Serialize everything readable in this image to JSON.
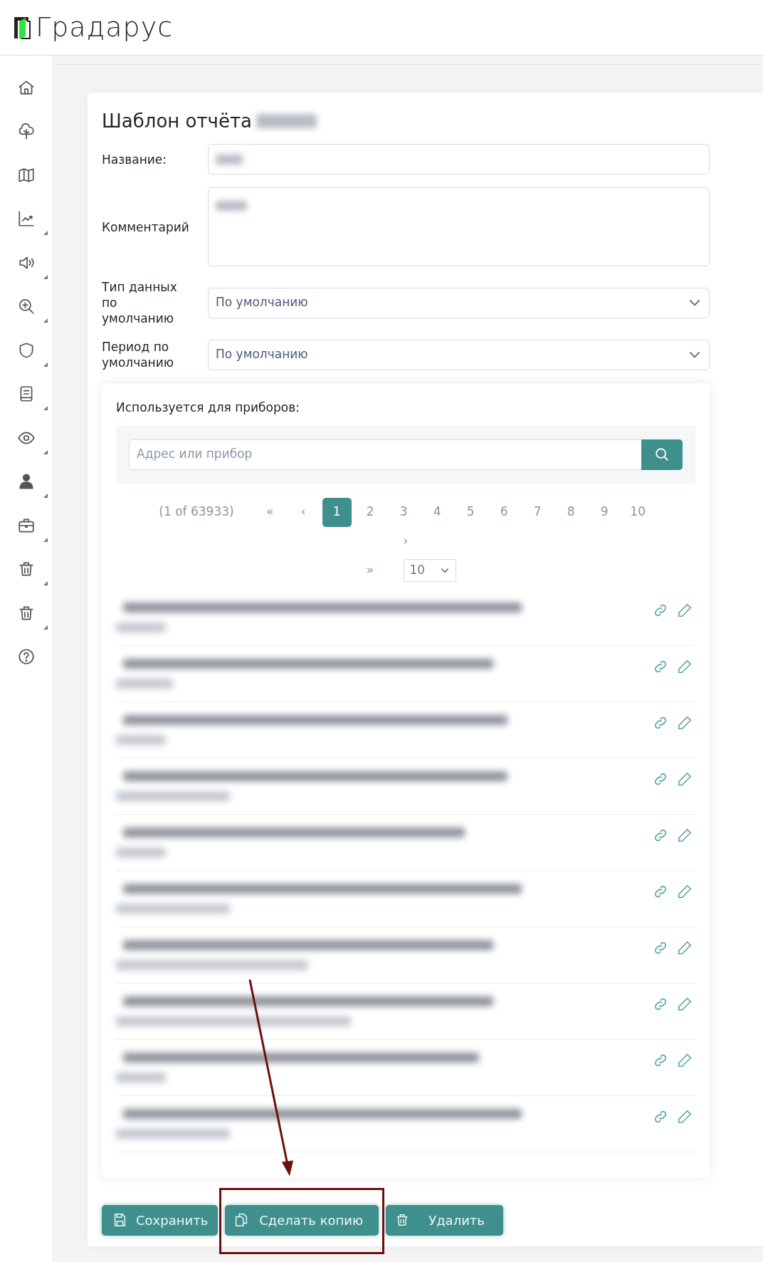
{
  "header": {
    "logo_text": "Градарус"
  },
  "sidebar": {
    "items": [
      {
        "kind": "home",
        "submenu": false
      },
      {
        "kind": "tree",
        "submenu": false
      },
      {
        "kind": "map",
        "submenu": false
      },
      {
        "kind": "chart",
        "submenu": true
      },
      {
        "kind": "speaker",
        "submenu": true
      },
      {
        "kind": "zoom",
        "submenu": true
      },
      {
        "kind": "shield",
        "submenu": true
      },
      {
        "kind": "book",
        "submenu": true
      },
      {
        "kind": "eye",
        "submenu": true
      },
      {
        "kind": "person",
        "submenu": true
      },
      {
        "kind": "briefcase",
        "submenu": true
      },
      {
        "kind": "trash",
        "submenu": true
      },
      {
        "kind": "trash",
        "submenu": true
      },
      {
        "kind": "help",
        "submenu": false
      }
    ]
  },
  "form": {
    "title": "Шаблон отчёта",
    "title_redacted": true,
    "fields": [
      {
        "kind": "input",
        "label": "Название:",
        "redacted": true
      },
      {
        "kind": "textarea",
        "label": "Комментарий",
        "redacted": true
      },
      {
        "kind": "select",
        "label": "Тип данных по умолчанию",
        "value": "По умолчанию"
      },
      {
        "kind": "select",
        "label": "Период по умолчанию",
        "value": "По умолчанию"
      }
    ]
  },
  "devices": {
    "heading": "Используется для приборов:",
    "search": {
      "placeholder": "Адрес или прибор"
    },
    "pagination": {
      "summary": "(1 of 63933)",
      "first": "«",
      "prev": "‹",
      "pages": [
        {
          "label": "1",
          "selected": true
        },
        {
          "label": "2",
          "selected": false
        },
        {
          "label": "3",
          "selected": false
        },
        {
          "label": "4",
          "selected": false
        },
        {
          "label": "5",
          "selected": false
        },
        {
          "label": "6",
          "selected": false
        },
        {
          "label": "7",
          "selected": false
        },
        {
          "label": "8",
          "selected": false
        },
        {
          "label": "9",
          "selected": false
        },
        {
          "label": "10",
          "selected": false
        }
      ],
      "next": "›",
      "last": "»",
      "per_page": "10"
    },
    "rows": [
      {
        "redacted": true
      },
      {
        "redacted": true
      },
      {
        "redacted": true
      },
      {
        "redacted": true
      },
      {
        "redacted": true
      },
      {
        "redacted": true
      },
      {
        "redacted": true
      },
      {
        "redacted": true
      },
      {
        "redacted": true
      },
      {
        "redacted": true
      }
    ]
  },
  "buttons": [
    {
      "kind": "save",
      "label": "Сохранить",
      "highlighted": false
    },
    {
      "kind": "copy",
      "label": "Сделать копию",
      "highlighted": true
    },
    {
      "kind": "delete",
      "label": "Удалить",
      "highlighted": false
    }
  ],
  "annotation": {
    "kind": "arrow",
    "color": "#6b0f0f"
  }
}
